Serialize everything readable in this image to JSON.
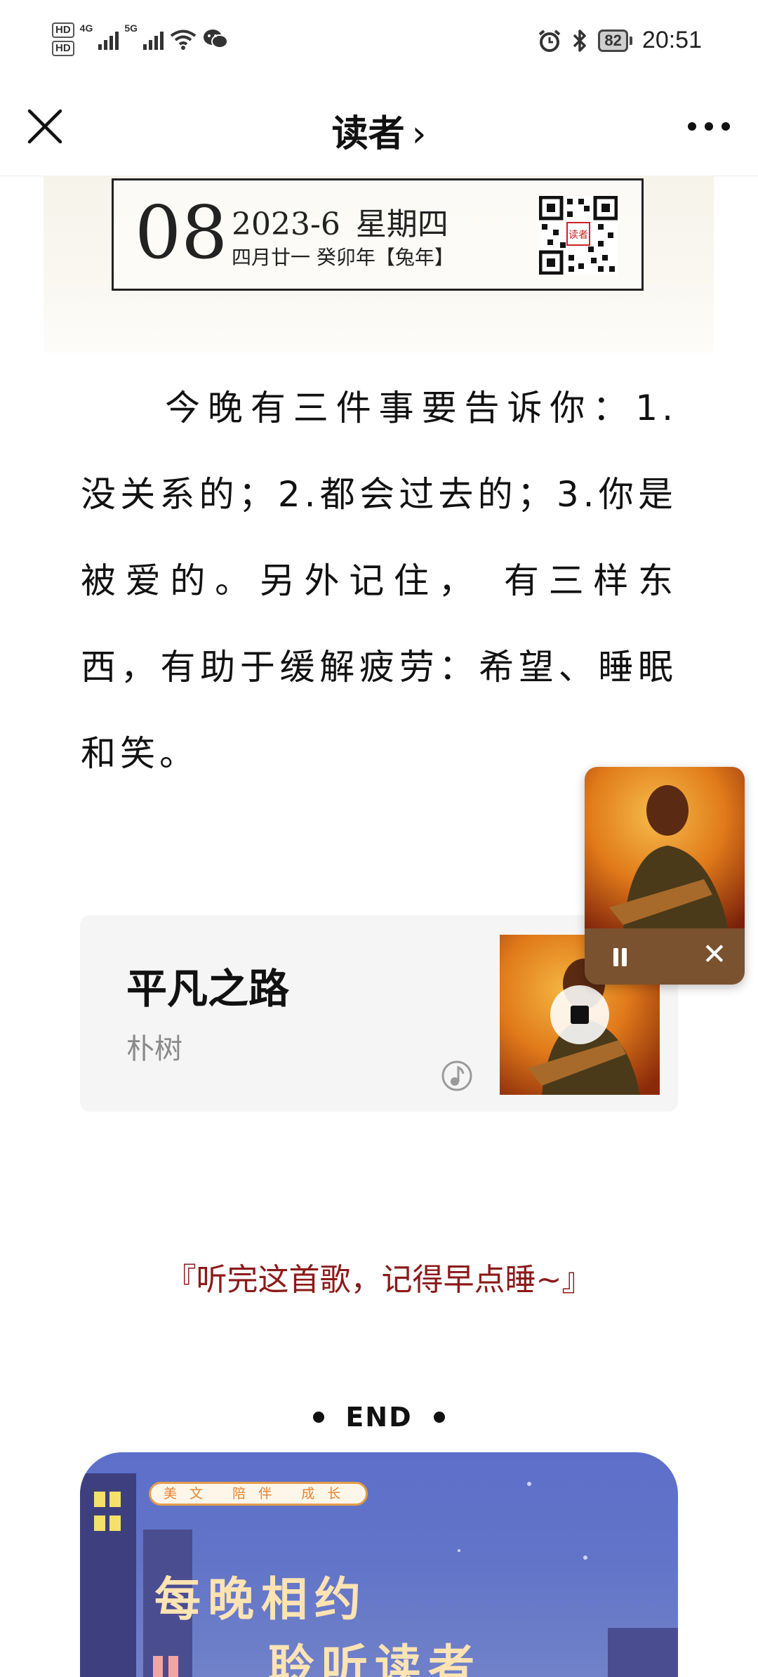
{
  "status_bar": {
    "hd1": "HD",
    "hd2": "HD",
    "net1": "4G",
    "net2": "5G",
    "battery": "82",
    "time": "20:51",
    "icons": [
      "alarm-icon",
      "bluetooth-icon",
      "wifi-icon",
      "wechat-icon"
    ]
  },
  "nav": {
    "title": "读者",
    "chevron": "›"
  },
  "date_banner": {
    "day": "08",
    "year_month": "2023-6",
    "weekday": "星期四",
    "lunar": "四月廿一 癸卯年【兔年】"
  },
  "article": {
    "text": "今晚有三件事要告诉你：1.没关系的；2.都会过去的；3.你是被爱的。另外记住， 有三样东西，有助于缓解疲劳：希望、睡眠和笑。"
  },
  "music_card": {
    "title": "平凡之路",
    "artist": "朴树"
  },
  "float_player": {
    "close": "✕"
  },
  "quote": "『听完这首歌，记得早点睡~』",
  "end_text": "END",
  "promo": {
    "pill": "美 文   陪 伴   成 长",
    "headline1": "每晚相约",
    "headline2": "聆听读者"
  },
  "colors": {
    "quote": "#8b1a1a",
    "promo_bg": "#6274c8",
    "promo_text": "#ffe3b3",
    "player_bar": "#7a5230"
  }
}
